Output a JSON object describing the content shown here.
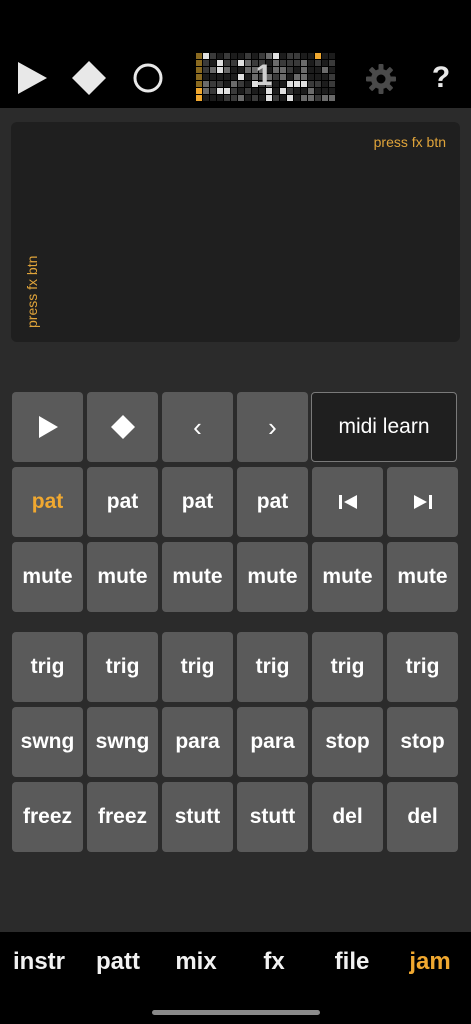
{
  "toolbar": {
    "play_icon": "play-icon",
    "stop_icon": "stop-icon",
    "record_icon": "record-icon",
    "pattern_number": "1",
    "settings_icon": "gear-icon",
    "help_label": "?"
  },
  "xy_pad": {
    "x_label": "press fx btn",
    "y_label": "press fx btn"
  },
  "transport": {
    "play_icon": "play-icon",
    "stop_icon": "stop-icon",
    "prev_label": "‹",
    "next_label": "›",
    "midi_learn_label": "midi learn"
  },
  "pattern_row": [
    "pat",
    "pat",
    "pat",
    "pat"
  ],
  "pattern_nav": {
    "prev_icon": "skip-back-icon",
    "next_icon": "skip-forward-icon"
  },
  "mute_row": [
    "mute",
    "mute",
    "mute",
    "mute",
    "mute",
    "mute"
  ],
  "trig_row": [
    "trig",
    "trig",
    "trig",
    "trig",
    "trig",
    "trig"
  ],
  "fx_row_1": [
    "swng",
    "swng",
    "para",
    "para",
    "stop",
    "stop"
  ],
  "fx_row_2": [
    "freez",
    "freez",
    "stutt",
    "stutt",
    "del",
    "del"
  ],
  "bottom_nav": {
    "items": [
      "instr",
      "patt",
      "mix",
      "fx",
      "file",
      "jam"
    ],
    "active": "jam"
  },
  "colors": {
    "accent": "#f0a830",
    "button": "#5a5a5a",
    "background": "#2b2b2b"
  }
}
